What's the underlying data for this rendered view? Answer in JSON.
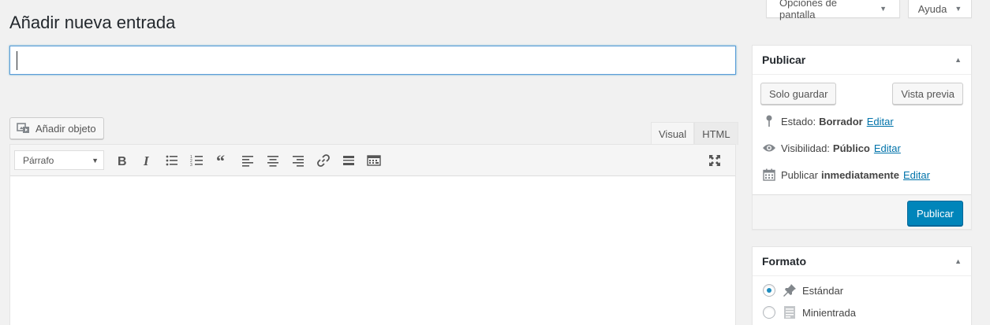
{
  "header": {
    "screen_options": "Opciones de pantalla",
    "help": "Ayuda"
  },
  "page": {
    "title": "Añadir nueva entrada",
    "title_input_value": ""
  },
  "editor": {
    "add_media": "Añadir objeto",
    "tabs": [
      {
        "label": "Visual",
        "active": true
      },
      {
        "label": "HTML",
        "active": false
      }
    ],
    "format_select": "Párrafo",
    "toolbar_icons": [
      "bold-icon",
      "italic-icon",
      "bullet-list-icon",
      "numbered-list-icon",
      "blockquote-icon",
      "align-left-icon",
      "align-center-icon",
      "align-right-icon",
      "link-icon",
      "read-more-icon",
      "toolbar-toggle-icon",
      "fullscreen-icon"
    ]
  },
  "publish_box": {
    "title": "Publicar",
    "save_draft": "Solo guardar",
    "preview": "Vista previa",
    "status_label": "Estado:",
    "status_value": "Borrador",
    "visibility_label": "Visibilidad:",
    "visibility_value": "Público",
    "publish_label": "Publicar",
    "publish_value": "inmediatamente",
    "edit_link": "Editar",
    "publish_button": "Publicar"
  },
  "format_box": {
    "title": "Formato",
    "options": [
      {
        "label": "Estándar",
        "checked": true,
        "icon": "pin-icon"
      },
      {
        "label": "Minientrada",
        "checked": false,
        "icon": "aside-icon"
      }
    ]
  },
  "colors": {
    "primary": "#0085ba",
    "link": "#0073aa",
    "background": "#f1f1f1"
  }
}
